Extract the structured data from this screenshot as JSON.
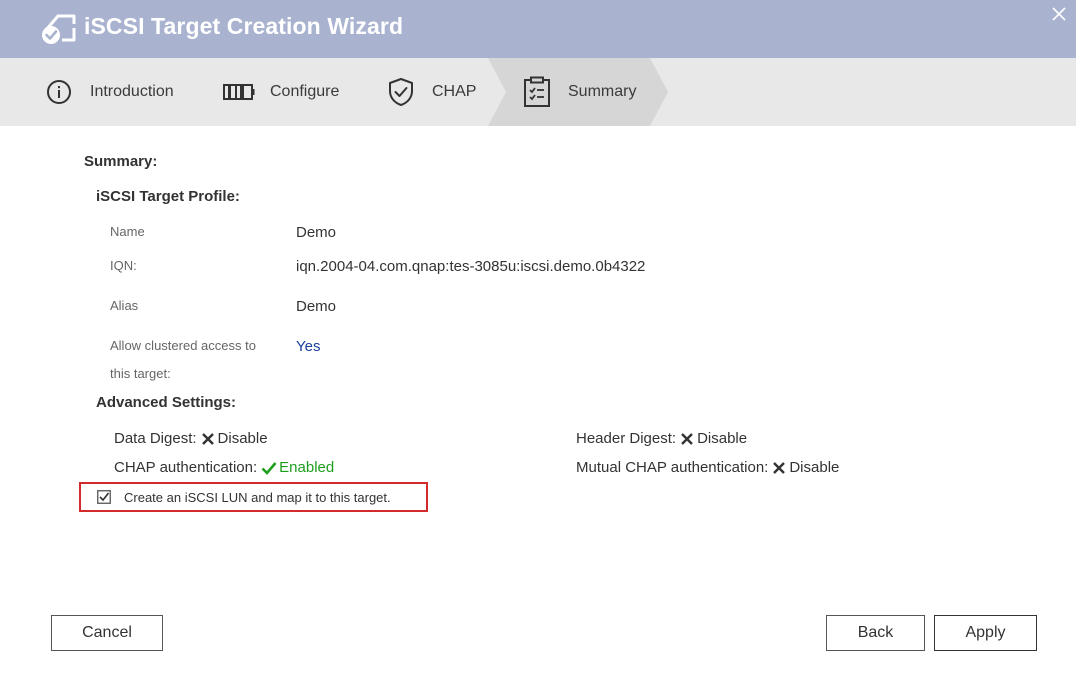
{
  "window": {
    "title": "iSCSI Target Creation Wizard"
  },
  "steps": [
    {
      "label": "Introduction",
      "icon": "info-icon"
    },
    {
      "label": "Configure",
      "icon": "configure-icon"
    },
    {
      "label": "CHAP",
      "icon": "shield-check-icon"
    },
    {
      "label": "Summary",
      "icon": "clipboard-check-icon",
      "active": true
    }
  ],
  "summary": {
    "heading": "Summary:",
    "profile_heading": "iSCSI Target Profile:",
    "rows": [
      {
        "label": "Name",
        "value": "Demo"
      },
      {
        "label": "IQN:",
        "value": "iqn.2004-04.com.qnap:tes-3085u:iscsi.demo.0b4322"
      },
      {
        "label": "Alias",
        "value": "Demo"
      },
      {
        "label_line1": "Allow clustered access to",
        "label_line2": "this target:",
        "value": "Yes"
      }
    ],
    "advanced_heading": "Advanced Settings:",
    "advanced": {
      "data_digest": {
        "label": "Data Digest:",
        "value": "Disable"
      },
      "header_digest": {
        "label": "Header Digest:",
        "value": "Disable"
      },
      "chap_auth": {
        "label": "CHAP authentication:",
        "value": "Enabled"
      },
      "mutual_chap_auth": {
        "label": "Mutual CHAP authentication:",
        "value": "Disable"
      }
    },
    "lun_checkbox": {
      "label": "Create an iSCSI LUN and map it to this target.",
      "checked": true
    }
  },
  "buttons": {
    "cancel": "Cancel",
    "back": "Back",
    "apply": "Apply"
  },
  "colors": {
    "titlebar": "#a9b3d0",
    "stepbar": "#e8e8e8",
    "active_step": "#d6d6d6",
    "enabled_green": "#1e9e1e",
    "link_blue": "#1a3f9c",
    "highlight_red": "#d32a2a"
  }
}
